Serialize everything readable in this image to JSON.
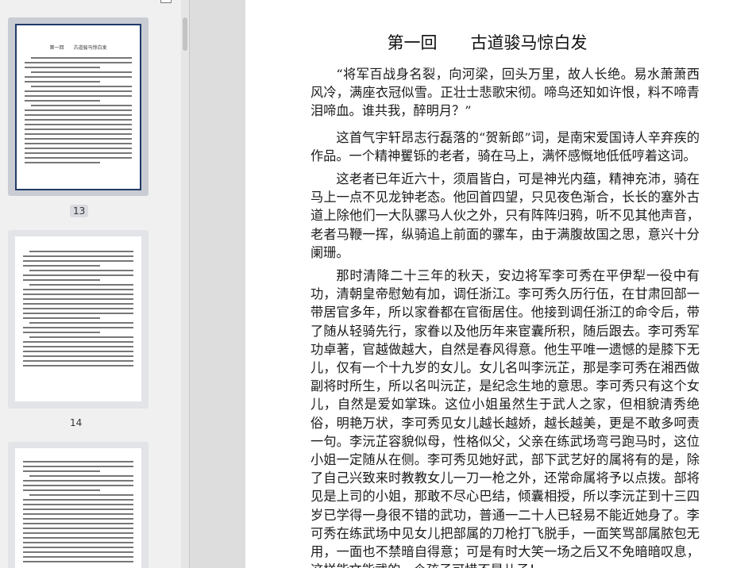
{
  "sidebar": {
    "thumbnails": [
      {
        "page_label": "13",
        "title": "第一回　　古道骏马惊白发",
        "selected": true
      },
      {
        "page_label": "14",
        "selected": false
      },
      {
        "page_label": "",
        "selected": false
      }
    ]
  },
  "document": {
    "chapter_title": "第一回　　古道骏马惊白发",
    "paragraphs": [
      "“将军百战身名裂，向河梁，回头万里，故人长绝。易水萧萧西风冷，满座衣冠似雪。正壮士悲歌宋彻。啼鸟还知如许恨，料不啼青泪啼血。谁共我，醉明月？”",
      "这首气宇轩昂志行磊落的“贺新郎”词，是南宋爱国诗人辛弃疾的作品。一个精神矍铄的老者，骑在马上，满怀感慨地低低哼着这词。",
      "这老者已年近六十，须眉皆白，可是神光内蕴，精神充沛，骑在马上一点不见龙钟老态。他回首四望，只见夜色渐合，长长的塞外古道上除他们一大队骡马人伙之外，只有阵阵归鸦，听不见其他声音，老者马鞭一挥，纵骑追上前面的骡车，由于满腹故国之思，意兴十分阑珊。",
      "那时清降二十三年的秋天，安边将军李可秀在平伊犁一役中有功，清朝皇帝慰勉有加，调任浙江。李可秀久历行伍，在甘肃回部一带居官多年，所以家眷都在官衙居住。他接到调任浙江的命令后，带了随从轻骑先行，家眷以及他历年来宦囊所积，随后跟去。李可秀军功卓著，官越做越大，自然是春风得意。他生平唯一遗憾的是膝下无儿，仅有一个十九岁的女儿。女儿名叫李沅芷，那是李可秀在湘西做副将时所生，所以名叫沅芷，是纪念生地的意思。李可秀只有这个女儿，自然是爱如掌珠。这位小姐虽然生于武人之家，但相貌清秀绝俗，明艳万状，李可秀见女儿越长越娇，越长越美，更是不敢多呵责一句。李沅芷容貌似母，性格似父，父亲在练武场弯弓跑马时，这位小姐一定随从在侧。李可秀见她好武，部下武艺好的属将有的是，除了自己兴致来时教教女儿一刀一枪之外，还常命属将予以点拨。部将见是上司的小姐，那敢不尽心巴结，倾囊相授，所以李沅芷到十三四岁已学得一身很不错的武功，普通一二十人已轻易不能近她身了。李可秀在练武场中见女儿把部属的刀枪打飞脱手，一面笑骂部属脓包无用，一面也不禁暗自得意；可是有时大笑一场之后又不免暗暗叹息，这样能文能武的一个孩子可惜不是儿子！"
    ]
  }
}
